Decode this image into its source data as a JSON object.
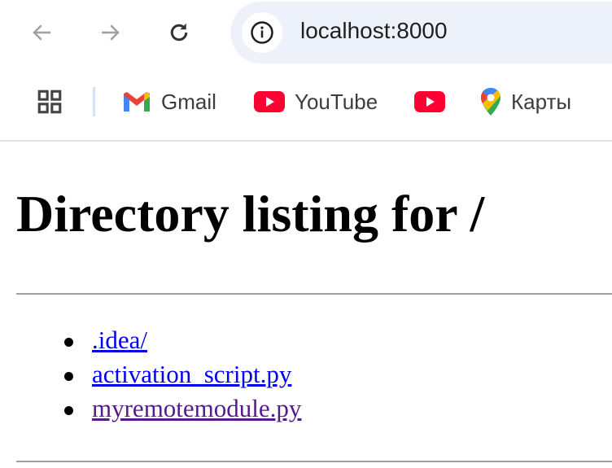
{
  "browser": {
    "url": "localhost:8000",
    "bookmarks": [
      {
        "label": "Gmail",
        "icon": "gmail-icon"
      },
      {
        "label": "YouTube",
        "icon": "youtube-icon"
      },
      {
        "label": "",
        "icon": "youtube-icon"
      },
      {
        "label": "Карты",
        "icon": "maps-icon"
      }
    ]
  },
  "page": {
    "title": "Directory listing for /",
    "files": [
      {
        "name": ".idea/",
        "color": "#0000ee"
      },
      {
        "name": "activation_script.py",
        "color": "#0000ee"
      },
      {
        "name": "myremotemodule.py",
        "color": "#551a8b"
      }
    ]
  }
}
